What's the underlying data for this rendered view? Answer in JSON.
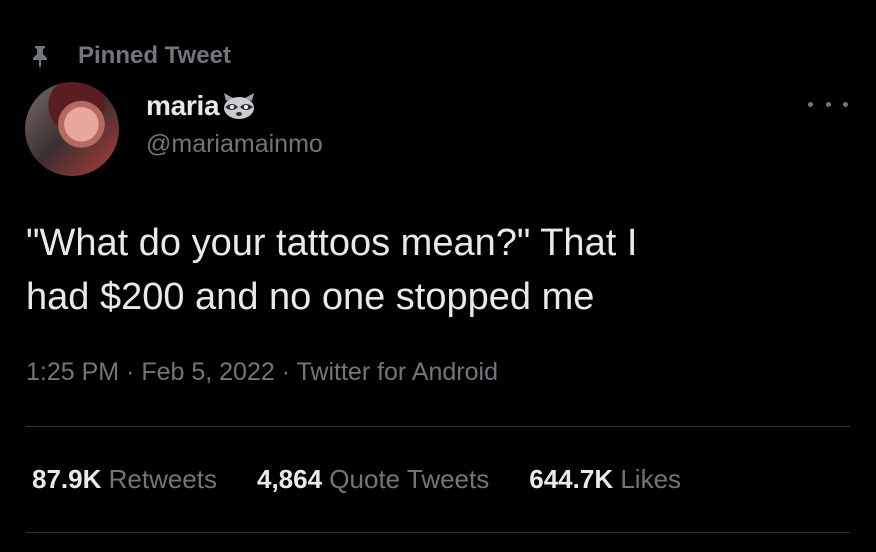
{
  "pinned": {
    "label": "Pinned Tweet",
    "icon": "pin-icon"
  },
  "author": {
    "display_name": "maria",
    "emoji_icon": "raccoon-icon",
    "handle": "@mariamainmo",
    "avatar_icon": "avatar"
  },
  "tweet": {
    "text": "\"What do your tattoos mean?\" That I\nhad $200 and no one stopped me",
    "meta": "1:25 PM · Feb 5, 2022 · Twitter for Android"
  },
  "stats": [
    {
      "count": "87.9K",
      "label": "Retweets"
    },
    {
      "count": "4,864",
      "label": "Quote Tweets"
    },
    {
      "count": "644.7K",
      "label": "Likes"
    }
  ],
  "colors": {
    "background": "#000000",
    "text": "#e7e9ea",
    "muted": "#71767b",
    "divider": "#2f3336"
  }
}
